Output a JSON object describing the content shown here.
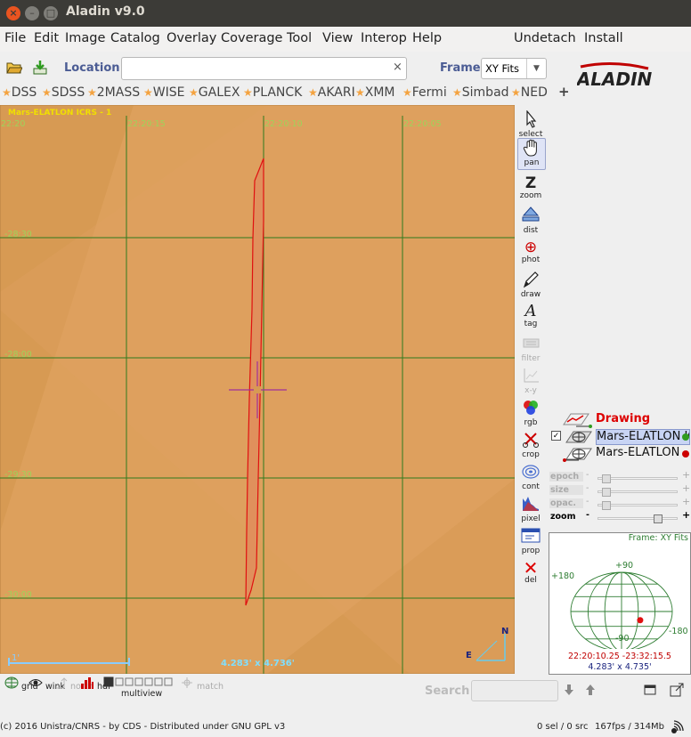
{
  "window": {
    "title": "Aladin v9.0",
    "close_glyph": "×",
    "min_glyph": "–",
    "max_glyph": "□"
  },
  "menu": {
    "items": [
      "File",
      "Edit",
      "Image",
      "Catalog",
      "Overlay",
      "Coverage",
      "Tool",
      "View",
      "Interop",
      "Help"
    ],
    "right_items": [
      "Undetach",
      "Install"
    ]
  },
  "location": {
    "label": "Location",
    "value": "",
    "clear_glyph": "×",
    "frame_label": "Frame",
    "frame_value": "XY Fits",
    "frame_arrow": "▼",
    "logo_text": "ALADIN"
  },
  "servers": {
    "items": [
      "DSS",
      "SDSS",
      "2MASS",
      "WISE",
      "GALEX",
      "PLANCK",
      "AKARI",
      "XMM",
      "Fermi",
      "Simbad",
      "NED"
    ],
    "star_glyph": "★",
    "plus_glyph": "+"
  },
  "view": {
    "title": "Mars-ELATLON ICRS - 1",
    "ra_labels": [
      "22:20",
      "22:20:15",
      "22:20:10",
      "22:20:05"
    ],
    "dec_labels": [
      "-28:30",
      "-28:00",
      "-29:30",
      "-30:00"
    ],
    "size_label": "4.283' x 4.736'",
    "scale_label": "1'",
    "compass_north": "N",
    "compass_east": "E"
  },
  "tools": [
    {
      "name": "select",
      "label": "select",
      "enabled": true,
      "active": false
    },
    {
      "name": "pan",
      "label": "pan",
      "enabled": true,
      "active": true
    },
    {
      "name": "zoom",
      "label": "zoom",
      "enabled": true,
      "active": false
    },
    {
      "name": "dist",
      "label": "dist",
      "enabled": true,
      "active": false
    },
    {
      "name": "phot",
      "label": "phot",
      "enabled": true,
      "active": false
    },
    {
      "name": "draw",
      "label": "draw",
      "enabled": true,
      "active": false
    },
    {
      "name": "tag",
      "label": "tag",
      "enabled": true,
      "active": false
    },
    {
      "name": "filter",
      "label": "filter",
      "enabled": false,
      "active": false
    },
    {
      "name": "x-y",
      "label": "x-y",
      "enabled": false,
      "active": false
    },
    {
      "name": "rgb",
      "label": "rgb",
      "enabled": true,
      "active": false
    },
    {
      "name": "crop",
      "label": "crop",
      "enabled": true,
      "active": false
    },
    {
      "name": "cont",
      "label": "cont",
      "enabled": true,
      "active": false
    },
    {
      "name": "pixel",
      "label": "pixel",
      "enabled": true,
      "active": false
    },
    {
      "name": "prop",
      "label": "prop",
      "enabled": true,
      "active": false
    },
    {
      "name": "del",
      "label": "del",
      "enabled": true,
      "active": false
    }
  ],
  "tool_glyphs": {
    "zoom": "Z",
    "phot": "⊕",
    "tag": "A",
    "del": "✕"
  },
  "layers": [
    {
      "name": "Drawing",
      "type": "drawing",
      "checked": false
    },
    {
      "name": "Mars-ELATLON ICRS - 1",
      "type": "image",
      "checked": true,
      "selected": true
    },
    {
      "name": "Mars-ELATLON",
      "type": "image",
      "checked": false,
      "selected": false
    }
  ],
  "layer_check_glyph": "✓",
  "sliders": [
    {
      "label": "epoch",
      "enabled": false,
      "position": 0.05
    },
    {
      "label": "size",
      "enabled": false,
      "position": 0.05
    },
    {
      "label": "opac.",
      "enabled": false,
      "position": 0.05
    },
    {
      "label": "zoom",
      "enabled": true,
      "position": 0.78
    }
  ],
  "slider_glyphs": {
    "dash": "-",
    "plus": "+"
  },
  "minimap": {
    "frame": "Frame: XY Fits",
    "plus90": "+90",
    "minus90": "-90",
    "plus180": "+180",
    "minus180": "-180",
    "coords": "22:20:10.25 -23:32:15.5",
    "size": "4.283' x 4.735'",
    "dot_lon": 10,
    "dot_lat": -20
  },
  "bottom_tools": [
    {
      "name": "grid",
      "label": "grid",
      "enabled": true
    },
    {
      "name": "wink",
      "label": "wink",
      "enabled": true
    },
    {
      "name": "north",
      "label": "north",
      "enabled": false
    },
    {
      "name": "hdr",
      "label": "hdr",
      "enabled": true
    },
    {
      "name": "multiview",
      "label": "multiview",
      "enabled": true
    },
    {
      "name": "match",
      "label": "match",
      "enabled": false
    }
  ],
  "search": {
    "label": "Search",
    "value": ""
  },
  "status": {
    "copyright": "(c) 2016 Unistra/CNRS - by CDS - Distributed under GNU GPL v3",
    "selection": "0 sel / 0 src",
    "memory": "167fps / 314Mb"
  },
  "colors": {
    "sky": "#d79a53",
    "sky_light": "#e2a865",
    "grid": "#2f7a1e",
    "grid_label": "#9ed35a",
    "contour": "#e01010",
    "cross": "#a0309a",
    "link": "#4b5c94"
  }
}
